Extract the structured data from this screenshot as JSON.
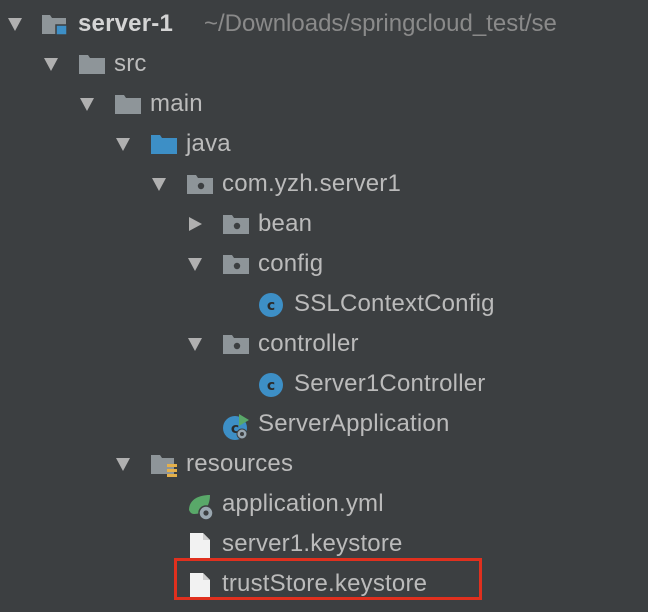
{
  "project": {
    "name": "server-1",
    "path": "~/Downloads/springcloud_test/se"
  },
  "nodes": {
    "src": "src",
    "main": "main",
    "java": "java",
    "package": "com.yzh.server1",
    "bean": "bean",
    "config": "config",
    "ssl_context_config": "SSLContextConfig",
    "controller": "controller",
    "server1_controller": "Server1Controller",
    "server_application": "ServerApplication",
    "resources": "resources",
    "application_yml": "application.yml",
    "server1_keystore": "server1.keystore",
    "truststore_keystore": "trustStore.keystore"
  },
  "colors": {
    "background": "#3c3f41",
    "text": "#bbbbbb",
    "folder": "#8e9599",
    "source_folder": "#3d8fc6",
    "class_icon": "#3d8fc6",
    "highlight_border": "#e0301e"
  },
  "icons": {
    "expanded": "triangle-down-icon",
    "collapsed": "triangle-right-icon",
    "folder": "folder-icon",
    "package": "package-icon",
    "class": "class-icon",
    "file": "file-icon",
    "spring_boot": "spring-boot-icon"
  }
}
